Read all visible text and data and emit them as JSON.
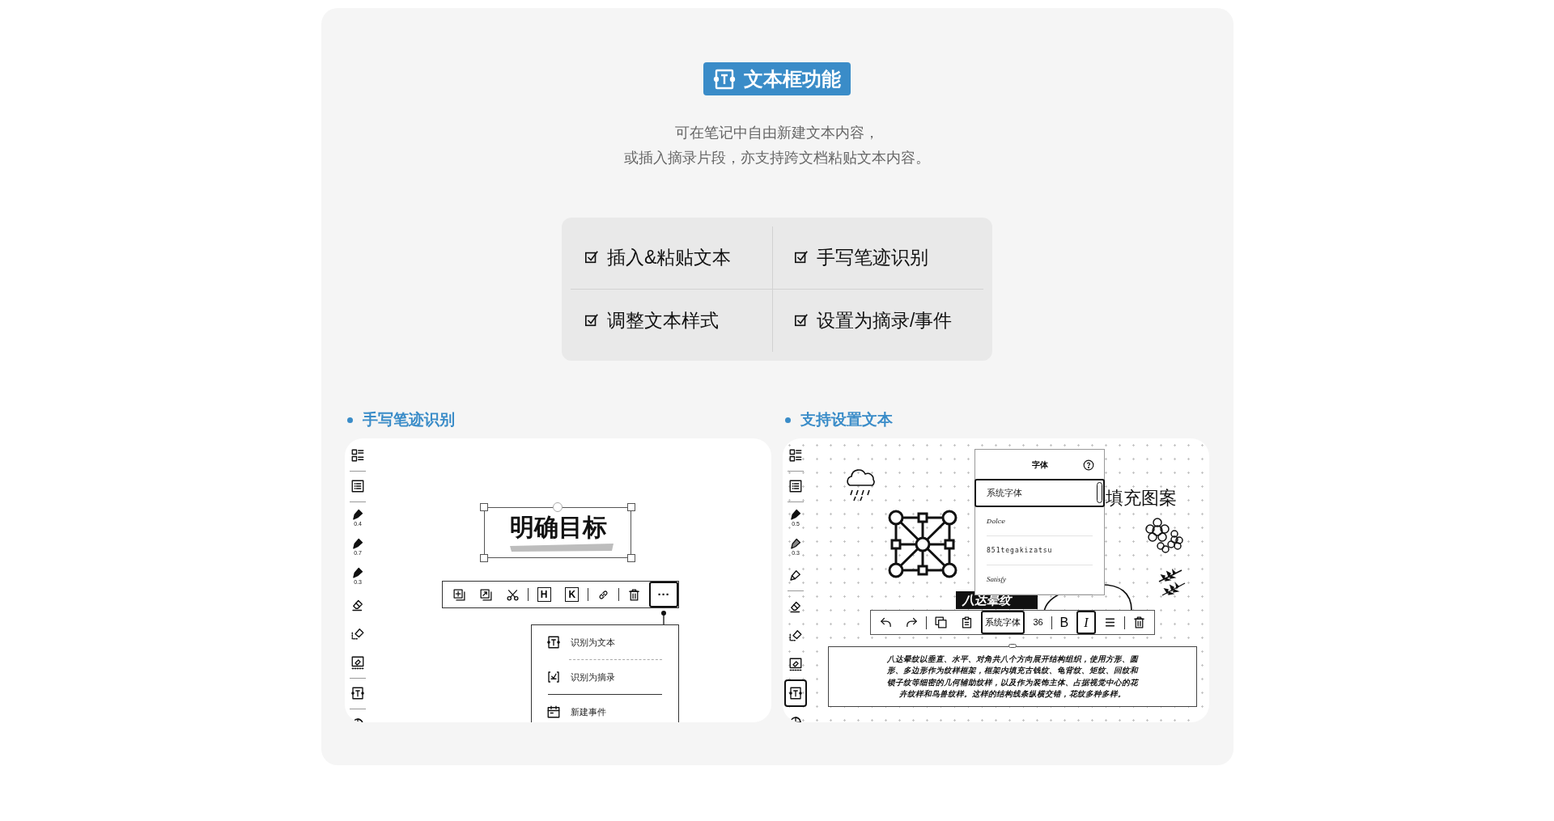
{
  "badge": {
    "label": "文本框功能"
  },
  "description": [
    "可在笔记中自由新建文本内容，",
    "或插入摘录片段，亦支持跨文档粘贴文本内容。"
  ],
  "features": [
    {
      "label": "插入&粘贴文本",
      "checked": true
    },
    {
      "label": "手写笔迹识别",
      "checked": true
    },
    {
      "label": "调整文本样式",
      "checked": true
    },
    {
      "label": "设置为摘录/事件",
      "checked": true
    }
  ],
  "sections": [
    {
      "heading": "手写笔迹识别",
      "screen": {
        "kind": "recognition",
        "tools": [
          {
            "kind": "layout",
            "selected": false,
            "divider_after": true
          },
          {
            "kind": "list",
            "selected": false,
            "divider_after": true
          },
          {
            "kind": "pen",
            "value": "0.4",
            "selected": false,
            "divider_after": false
          },
          {
            "kind": "pen",
            "value": "0.7",
            "selected": false,
            "divider_after": false
          },
          {
            "kind": "pen",
            "value": "0.3",
            "selected": false,
            "divider_after": false
          },
          {
            "kind": "eraser",
            "selected": false,
            "divider_after": false
          },
          {
            "kind": "lasso_eraser",
            "selected": false,
            "divider_after": false
          },
          {
            "kind": "clear",
            "selected": false,
            "divider_after": true
          },
          {
            "kind": "text",
            "selected": false,
            "divider_after": true
          },
          {
            "kind": "shape",
            "selected": false,
            "divider_after": false
          }
        ],
        "selection_text": "明确目标",
        "toolbar": [
          {
            "kind": "insert",
            "selected": false
          },
          {
            "kind": "export",
            "selected": false
          },
          {
            "kind": "cut",
            "selected": false
          },
          {
            "kind": "separator"
          },
          {
            "kind": "letter",
            "label": "H",
            "selected": false
          },
          {
            "kind": "letter",
            "label": "K",
            "selected": false
          },
          {
            "kind": "separator"
          },
          {
            "kind": "link",
            "selected": false
          },
          {
            "kind": "separator"
          },
          {
            "kind": "delete",
            "selected": false
          },
          {
            "kind": "more",
            "label": "···",
            "selected": true
          }
        ],
        "menu": [
          {
            "kind": "text",
            "label": "识别为文本"
          },
          {
            "kind": "excerpt",
            "label": "识别为摘录"
          },
          {
            "kind": "event",
            "label": "新建事件"
          }
        ]
      }
    },
    {
      "heading": "支持设置文本",
      "screen": {
        "kind": "text_style",
        "tools": [
          {
            "kind": "layout",
            "selected": false,
            "divider_after": true
          },
          {
            "kind": "list",
            "selected": false,
            "divider_after": true
          },
          {
            "kind": "pen",
            "value": "0.5",
            "selected": false,
            "divider_after": false
          },
          {
            "kind": "marker",
            "value": "0.3",
            "selected": false,
            "divider_after": false
          },
          {
            "kind": "highlighter",
            "selected": false,
            "divider_after": true
          },
          {
            "kind": "eraser",
            "selected": false,
            "divider_after": false
          },
          {
            "kind": "lasso_eraser",
            "selected": false,
            "divider_after": false
          },
          {
            "kind": "clear",
            "selected": false,
            "divider_after": false
          },
          {
            "kind": "text",
            "selected": true,
            "divider_after": false
          },
          {
            "kind": "shape",
            "selected": false,
            "divider_after": false
          }
        ],
        "font_panel": {
          "title": "字体",
          "options": [
            {
              "label": "系统字体",
              "selected": true
            },
            {
              "label": "Dolce",
              "selected": false
            },
            {
              "label": "851tegakizatsu",
              "selected": false
            },
            {
              "label": "Satisfy",
              "selected": false
            }
          ]
        },
        "handwriting": [
          {
            "kind": "caption",
            "text": "填充图案"
          },
          {
            "kind": "banner",
            "text": "八达晕纹"
          }
        ],
        "toolbar": [
          {
            "kind": "undo",
            "selected": false
          },
          {
            "kind": "redo",
            "selected": false
          },
          {
            "kind": "separator"
          },
          {
            "kind": "copy",
            "selected": false
          },
          {
            "kind": "paste",
            "selected": false
          },
          {
            "kind": "font",
            "label": "系统字体",
            "selected": true
          },
          {
            "kind": "size",
            "label": "36",
            "selected": false
          },
          {
            "kind": "separator"
          },
          {
            "kind": "bold",
            "label": "B",
            "selected": false
          },
          {
            "kind": "italic",
            "label": "I",
            "selected": true
          },
          {
            "kind": "align",
            "selected": false
          },
          {
            "kind": "separator"
          },
          {
            "kind": "delete",
            "selected": false
          }
        ],
        "text_box": "八达晕纹以垂直、水平、对角共八个方向展开结构组织，使用方形、圆形、多边形作为纹样框架，框架内填充古钱纹、龟背纹、矩纹、回纹和锁子纹等细密的几何辅助纹样，以及作为装饰主体、占据视觉中心的花卉纹样和鸟兽纹样。这样的结构线条纵横交错，花纹多种多样。"
      }
    }
  ]
}
